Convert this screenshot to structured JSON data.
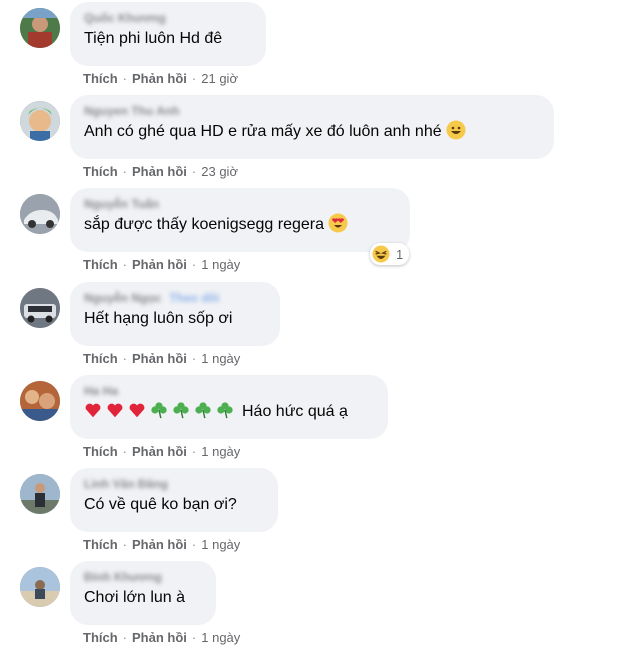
{
  "actions": {
    "like": "Thích",
    "reply": "Phản hồi",
    "sep": "·"
  },
  "comments": [
    {
      "name": "Quốc Khương",
      "text": "Tiện phi luôn Hd đê",
      "time": "21 giờ"
    },
    {
      "name": "Nguyen Thu Anh",
      "text": "Anh có ghé qua HD e rửa mấy xe đó luôn anh nhé",
      "time": "23 giờ",
      "emoji": "grinning-face-icon"
    },
    {
      "name": "Nguyễn Tuấn",
      "text": "sắp được thấy koenigsegg regera",
      "time": "1 ngày",
      "emoji": "heart-eyes-icon",
      "reaction": {
        "icon": "laughing-face-icon",
        "count": "1"
      }
    },
    {
      "name": "Nguyễn Ngọc",
      "tag": "Theo dõi",
      "text": "Hết hạng luôn sốp ơi",
      "time": "1 ngày"
    },
    {
      "name": "Ha Ha",
      "prefix_icons": [
        "red-heart-icon",
        "red-heart-icon",
        "red-heart-icon",
        "shamrock-icon",
        "shamrock-icon",
        "shamrock-icon",
        "shamrock-icon"
      ],
      "text": "Háo hức quá ạ",
      "time": "1 ngày"
    },
    {
      "name": "Linh Văn Đăng",
      "text": "Có về quê ko bạn ơi?",
      "time": "1 ngày"
    },
    {
      "name": "Đinh Khương",
      "text": "Chơi lớn lun à",
      "time": "1 ngày"
    }
  ],
  "colors": {
    "bubble": "#f0f2f5",
    "meta": "#65676b",
    "text": "#050505"
  }
}
